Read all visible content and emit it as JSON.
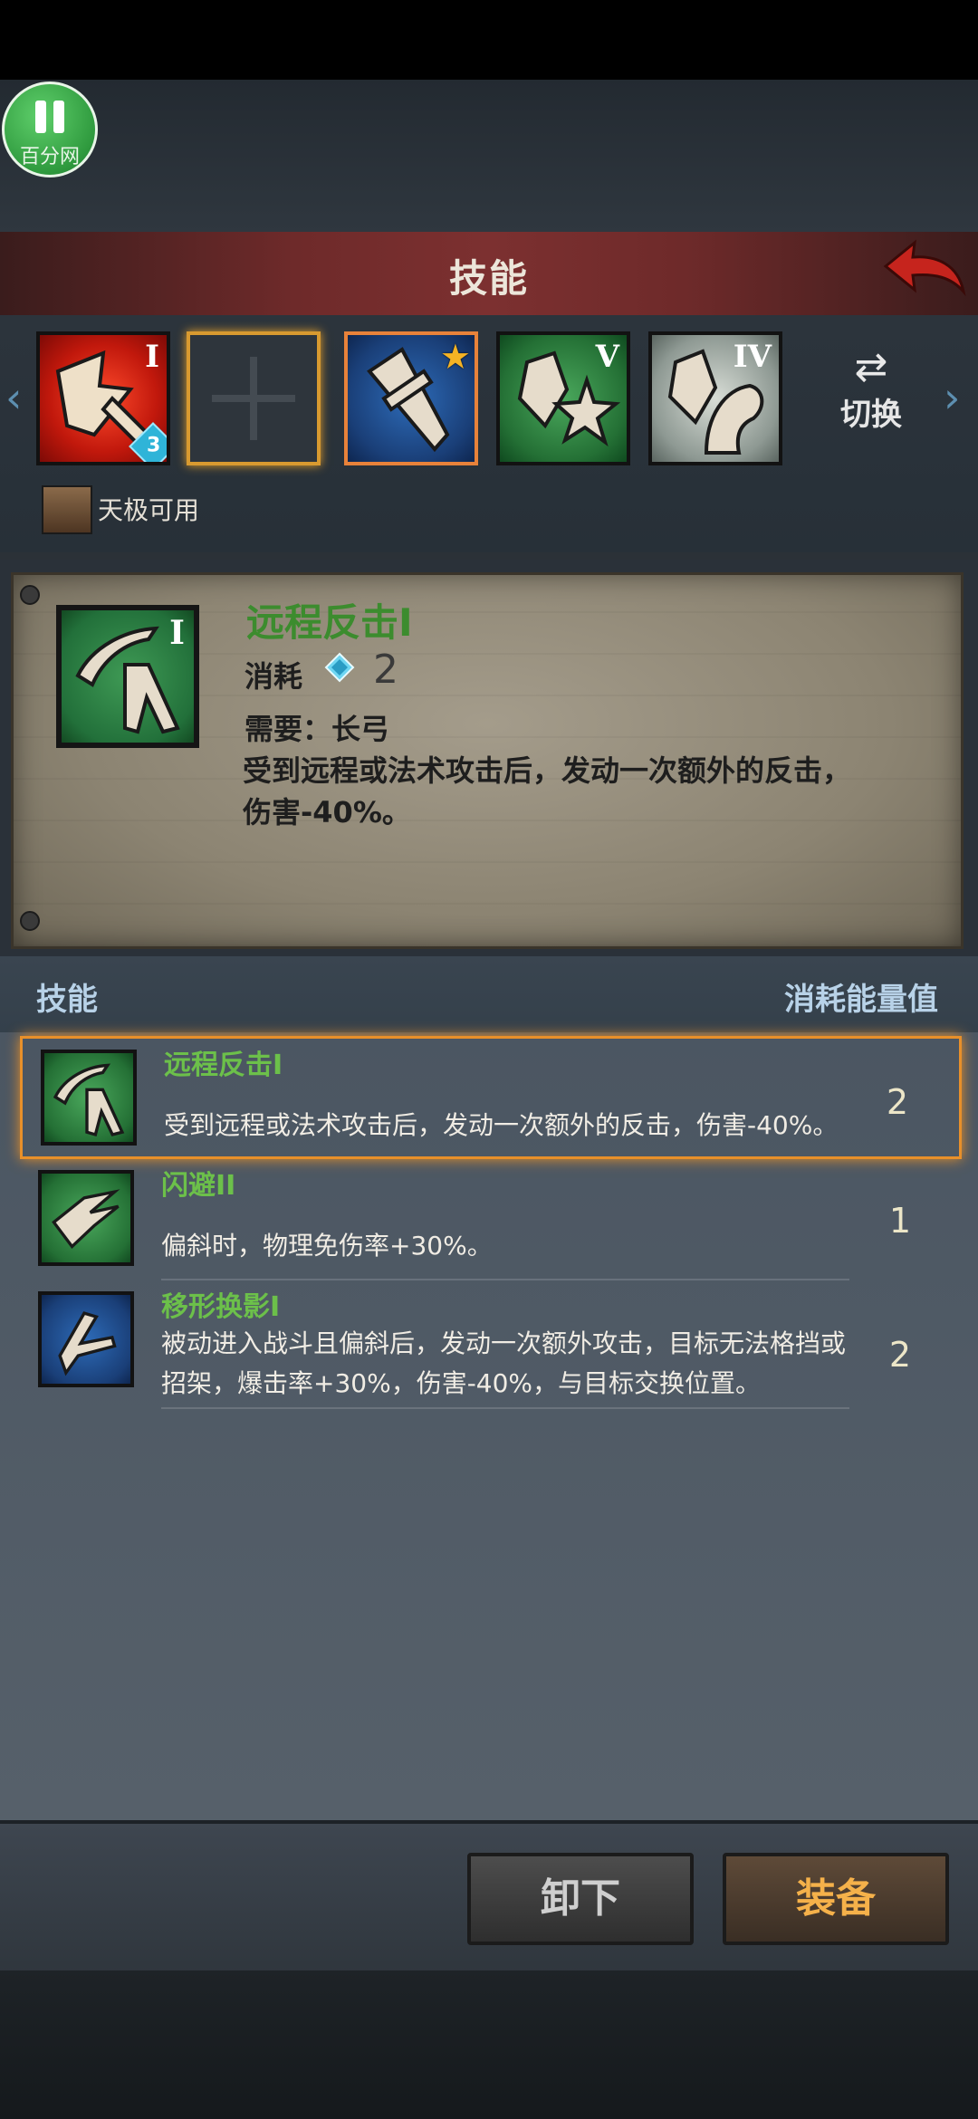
{
  "header": {
    "title": "技能"
  },
  "slots": [
    {
      "roman": "I",
      "badge": "3"
    },
    {
      "roman": ""
    },
    {
      "roman": ""
    },
    {
      "roman": "V"
    },
    {
      "roman": "IV"
    }
  ],
  "switch_label": "切换",
  "hero_label": "天极可用",
  "detail": {
    "roman": "I",
    "name": "远程反击I",
    "cost_label": "消耗",
    "cost_value": "2",
    "requirement": "需要：长弓",
    "description": "受到远程或法术攻击后，发动一次额外的反击，伤害-40%。"
  },
  "list_header": {
    "left": "技能",
    "right": "消耗能量值"
  },
  "skills": [
    {
      "name": "远程反击I",
      "description": "受到远程或法术攻击后，发动一次额外的反击，伤害-40%。",
      "cost": "2"
    },
    {
      "name": "闪避II",
      "description": "偏斜时，物理免伤率+30%。",
      "cost": "1"
    },
    {
      "name": "移形换影I",
      "description": "被动进入战斗且偏斜后，发动一次额外攻击，目标无法格挡或招架，爆击率+30%，伤害-40%，与目标交换位置。",
      "cost": "2"
    }
  ],
  "buttons": {
    "unload": "卸下",
    "equip": "装备"
  },
  "watermark": "百分网",
  "colors": {
    "accent_orange": "#e8902a",
    "skill_name_green": "#6cc04a",
    "equip_text": "#f5b14a"
  }
}
